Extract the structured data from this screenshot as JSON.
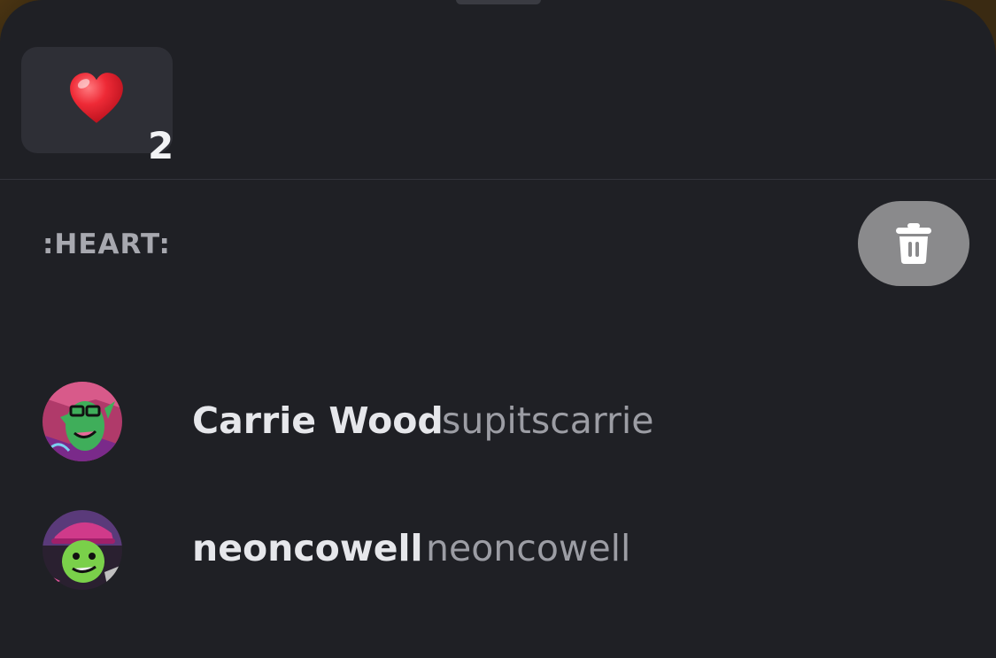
{
  "reaction": {
    "emoji_icon": "heart-emoji-icon",
    "count": "2"
  },
  "emoji_label": ":HEART:",
  "remove_icon": "trash-icon",
  "users": [
    {
      "display_name": "Carrie Wood",
      "username": "supitscarrie"
    },
    {
      "display_name": "neoncowell",
      "username": "neoncowell"
    }
  ],
  "colors": {
    "sheet_bg": "#1f2025",
    "chip_bg": "#2e2f36",
    "trash_button_bg": "#8a8a8c",
    "display_name": "#e6e7eb",
    "username": "#9c9da4",
    "heart": "#e8202e"
  }
}
